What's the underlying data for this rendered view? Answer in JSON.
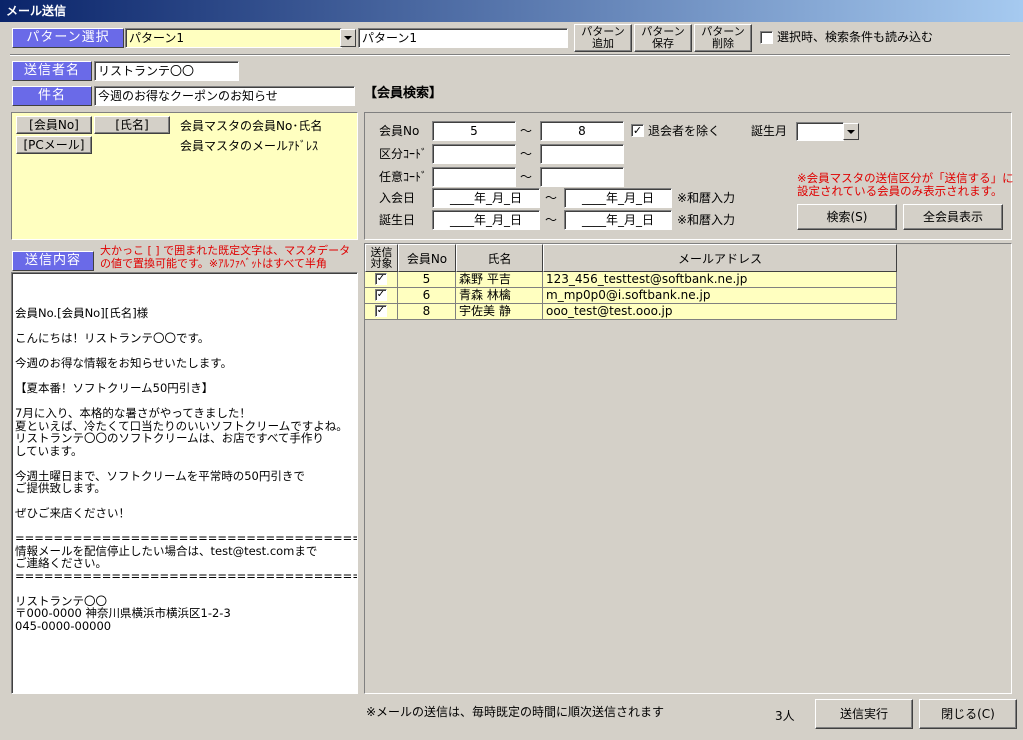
{
  "window": {
    "title": "メール送信"
  },
  "pattern": {
    "label": "パターン選択",
    "selected": "パターン1",
    "name_value": "パターン1",
    "add_line1": "パターン",
    "add_line2": "追加",
    "save_line1": "パターン",
    "save_line2": "保存",
    "delete_line1": "パターン",
    "delete_line2": "削除",
    "load_conditions_label": "選択時、検索条件も読み込む",
    "load_conditions_checked": false
  },
  "sender": {
    "label": "送信者名",
    "value": "リストランテ〇〇"
  },
  "subject": {
    "label": "件名",
    "value": "今週のお得なクーポンのお知らせ"
  },
  "insert": {
    "member_no_btn": "[会員No]",
    "name_btn": "[氏名]",
    "pc_mail_btn": "[PCメール]",
    "member_desc": "会員マスタの会員No･氏名",
    "mail_desc": "会員マスタのメールｱﾄﾞﾚｽ"
  },
  "body": {
    "label": "送信内容",
    "note_line1": "大かっこ [ ] で囲まれた既定文字は、マスタデータ",
    "note_line2": "の値で置換可能です。※ｱﾙﾌｧﾍﾞｯﾄはすべて半角",
    "text": "会員No.[会員No][氏名]様\n\nこんにちは！リストランテ〇〇です。\n\n今週のお得な情報をお知らせいたします。\n\n【夏本番！ソフトクリーム50円引き】\n\n7月に入り、本格的な暑さがやってきました！\n夏といえば、冷たくて口当たりのいいソフトクリームですよね。\nリストランテ〇〇のソフトクリームは、お店ですべて手作り\nしています。\n\n今週土曜日まで、ソフトクリームを平常時の50円引きで\nご提供致します。\n\nぜひご来店ください！\n\n==========================================\n情報メールを配信停止したい場合は、test@test.comまで\nご連絡ください。\n==========================================\n\nリストランテ〇〇\n〒000-0000 神奈川県横浜市横浜区1-2-3\n045-0000-00000"
  },
  "search": {
    "title": "【会員検索】",
    "member_no_label": "会員No",
    "member_no_from": "5",
    "member_no_to": "8",
    "tilde": "～",
    "exclude_withdrawn_label": "退会者を除く",
    "exclude_withdrawn_checked": true,
    "birth_month_label": "誕生月",
    "birth_month_value": "",
    "category_code_label": "区分ｺｰﾄﾞ",
    "category_code_from": "",
    "category_code_to": "",
    "any_code_label": "任意ｺｰﾄﾞ",
    "any_code_from": "",
    "any_code_to": "",
    "join_date_label": "入会日",
    "join_date_from": "____年_月_日",
    "join_date_to": "____年_月_日",
    "birth_date_label": "誕生日",
    "birth_date_from": "____年_月_日",
    "birth_date_to": "____年_月_日",
    "wareki_note": "※和暦入力",
    "notice_line1": "※会員マスタの送信区分が「送信する」に",
    "notice_line2": "設定されている会員のみ表示されます。",
    "search_btn": "検索(S)",
    "show_all_btn": "全会員表示"
  },
  "grid": {
    "columns": [
      "送信\n対象",
      "会員No",
      "氏名",
      "メールアドレス"
    ],
    "rows": [
      {
        "send": true,
        "member_no": "5",
        "name": "森野 平吉",
        "email": "123_456_testtest@softbank.ne.jp"
      },
      {
        "send": true,
        "member_no": "6",
        "name": "青森 林檎",
        "email": "m_mp0p0@i.softbank.ne.jp"
      },
      {
        "send": true,
        "member_no": "8",
        "name": "宇佐美 静",
        "email": "ooo_test@test.ooo.jp"
      }
    ]
  },
  "footer": {
    "note": "※メールの送信は、毎時既定の時間に順次送信されます",
    "count": "3人",
    "send_btn": "送信実行",
    "close_btn": "閉じる(C)"
  }
}
